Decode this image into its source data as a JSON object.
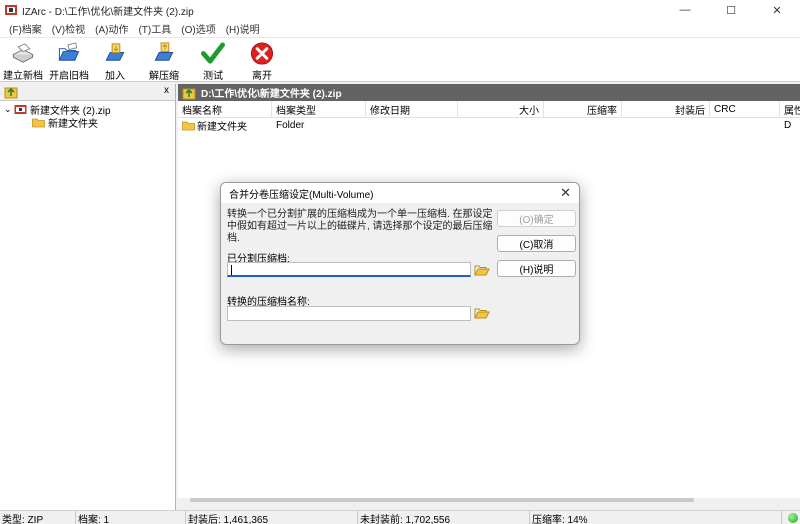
{
  "window": {
    "title": "IZArc - D:\\工作\\优化\\新建文件夹 (2).zip",
    "minimize": "—",
    "maximize": "☐",
    "close": "✕"
  },
  "menu": [
    "(F)档案",
    "(V)检视",
    "(A)动作",
    "(T)工具",
    "(O)选项",
    "(H)说明"
  ],
  "toolbar": {
    "new": "建立新档",
    "open": "开启旧档",
    "add": "加入",
    "extract": "解压缩",
    "test": "测试",
    "exit": "离开"
  },
  "left_pane": {
    "close": "x",
    "tree": [
      {
        "label": "新建文件夹 (2).zip",
        "expander": "⌄"
      },
      {
        "label": "新建文件夹"
      }
    ]
  },
  "right_pane": {
    "path": "D:\\工作\\优化\\新建文件夹 (2).zip",
    "columns": [
      "档案名称",
      "档案类型",
      "修改日期",
      "大小",
      "压缩率",
      "封装后",
      "CRC",
      "属性"
    ],
    "rows": [
      {
        "name": "新建文件夹",
        "type": "Folder",
        "date": "",
        "size": "",
        "ratio": "",
        "packed": "",
        "crc": "",
        "attr": "D"
      }
    ]
  },
  "status": {
    "type": "类型: ZIP",
    "files": "档案: 1",
    "packed": "封装后: 1,461,365",
    "unpacked": "未封装前: 1,702,556",
    "ratio": "压缩率: 14%"
  },
  "dialog": {
    "title": "合并分卷压缩设定(Multi-Volume)",
    "close": "✕",
    "description": "转换一个已分割扩展的压缩档成为一个单一压缩档. 在那设定中假如有超过一片以上的磁碟片, 请选择那个设定的最后压缩档.",
    "ok": "(O)确定",
    "cancel": "(C)取消",
    "help": "(H)说明",
    "split_label": "已分割压缩档:",
    "split_value": "",
    "convert_label": "转换的压缩档名称:",
    "convert_value": ""
  }
}
